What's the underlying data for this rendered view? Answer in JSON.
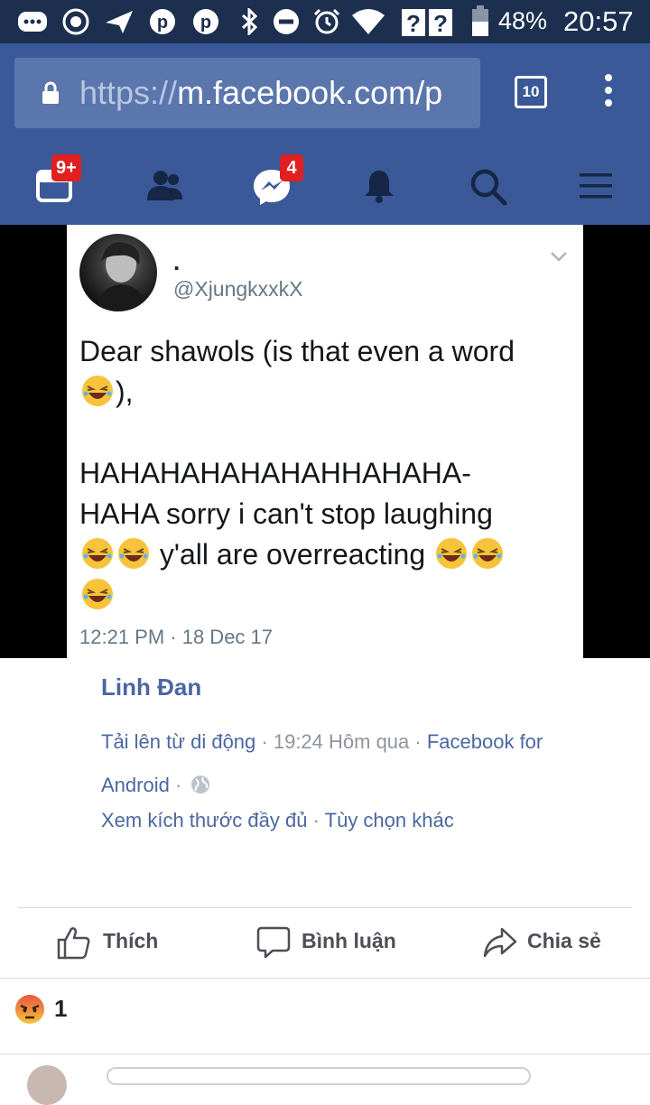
{
  "status_bar": {
    "battery_percent": "48%",
    "time": "20:57",
    "icons": [
      "messages-icon",
      "record-icon",
      "send-icon",
      "pinterest-icon",
      "pinterest-icon",
      "bluetooth-icon",
      "do-not-disturb-icon",
      "alarm-icon",
      "wifi-icon",
      "signal-unknown-icon",
      "signal-unknown-icon",
      "battery-icon"
    ]
  },
  "browser": {
    "url_scheme": "https://",
    "url_rest": "m.facebook.com/p",
    "tab_count": "10",
    "load_progress": 0.79
  },
  "fb_nav": {
    "items": [
      {
        "icon": "news-feed-icon",
        "badge": "9+"
      },
      {
        "icon": "friend-requests-icon",
        "badge": ""
      },
      {
        "icon": "messenger-icon",
        "badge": "4"
      },
      {
        "icon": "notifications-icon",
        "badge": ""
      },
      {
        "icon": "search-icon",
        "badge": ""
      },
      {
        "icon": "menu-icon",
        "badge": ""
      }
    ]
  },
  "tweet": {
    "display_name": ".",
    "handle": "@XjungkxxkX",
    "line1": "Dear shawols (is that even a word",
    "line2_tail": "),",
    "line3": "HAHAHAHAHAHAHHAHAHA-",
    "line4": "HAHA sorry i can't stop laughing",
    "line5_text": "y'all are overreacting",
    "timestamp": "12:21 PM · 18 Dec 17"
  },
  "post": {
    "poster_name": "Linh Đan",
    "upload_text": "Tải lên từ di động",
    "sep1": " · ",
    "time_text": "19:24 Hôm qua",
    "sep2": " · ",
    "source_text": "Facebook for Android",
    "sep3": " · ",
    "full_size_link": "Xem kích thước đầy đủ",
    "sep4": " · ",
    "more_options_link": "Tùy chọn khác"
  },
  "actions": {
    "like": "Thích",
    "comment": "Bình luận",
    "share": "Chia sẻ"
  },
  "reactions": {
    "count": "1",
    "type": "angry"
  },
  "colors": {
    "status_bar_bg": "#1d2f4f",
    "fb_blue": "#3b5998",
    "link_blue": "#4b67a1",
    "badge_red": "#e02020"
  }
}
